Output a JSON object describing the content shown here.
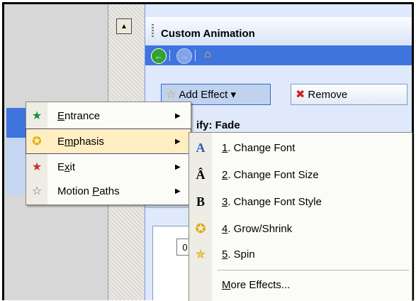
{
  "task_pane": {
    "title": "Custom Animation",
    "add_effect_label": "Add Effect ▾",
    "remove_label": "Remove",
    "modify_label": "ify: Fade",
    "list_number": "0"
  },
  "effect_menu": {
    "items": [
      {
        "label": "Entrance",
        "icon": "entrance-star-icon"
      },
      {
        "label": "Emphasis",
        "icon": "emphasis-star-icon",
        "selected": true
      },
      {
        "label": "Exit",
        "icon": "exit-star-icon"
      },
      {
        "label": "Motion Paths",
        "icon": "motion-path-star-icon"
      }
    ]
  },
  "emphasis_submenu": {
    "items": [
      {
        "label": "1. Change Font",
        "icon": "A"
      },
      {
        "label": "2. Change Font Size",
        "icon": "Aˆ"
      },
      {
        "label": "3. Change Font Style",
        "icon": "B"
      },
      {
        "label": "4. Grow/Shrink",
        "icon": "grow-shrink-star-icon"
      },
      {
        "label": "5. Spin",
        "icon": "spin-star-icon"
      }
    ],
    "more_label": "More Effects..."
  },
  "colors": {
    "nav_blue": "#3f73de",
    "menu_highlight": "#ffeec2"
  }
}
